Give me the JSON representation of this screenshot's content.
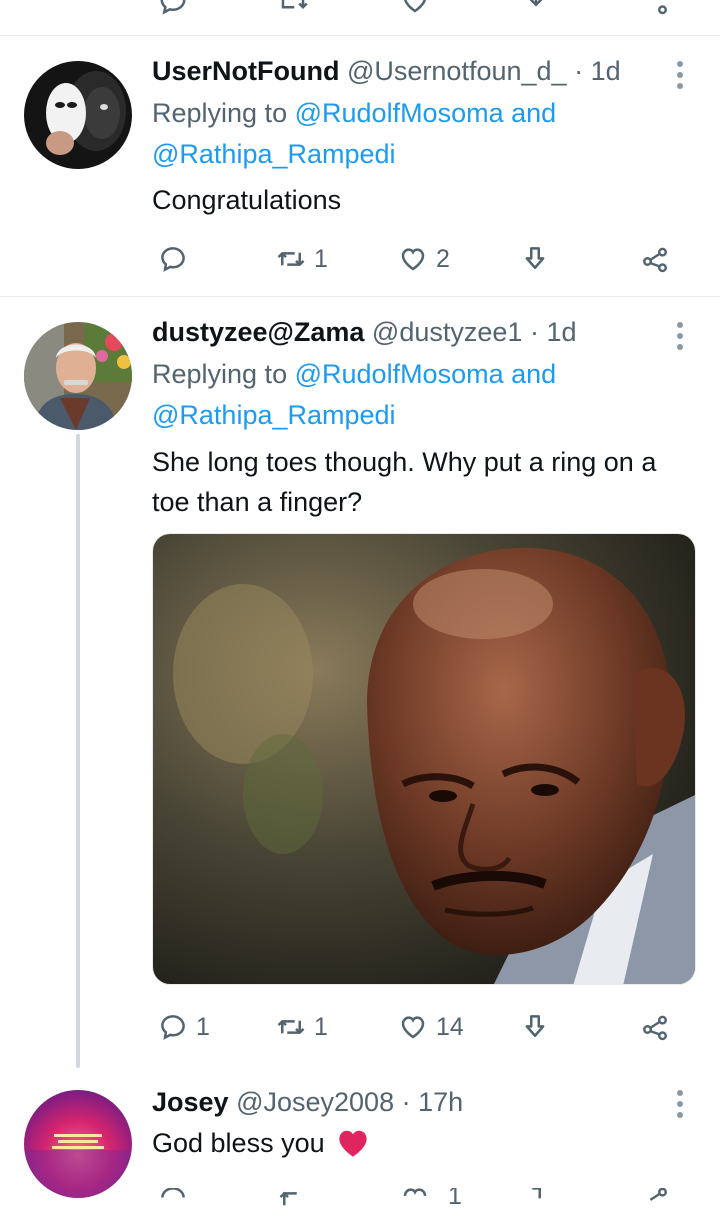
{
  "tweets": [
    {
      "display_name": "UserNotFound",
      "handle": "@Usernotfoun_d_",
      "dot": "·",
      "time": "1d",
      "replying_prefix": "Replying to",
      "mention_1": "@RudolfMosoma",
      "and": "and",
      "mention_2": "@Rathipa_Rampedi",
      "text": "Congratulations",
      "counts": {
        "reply": "",
        "retweet": "1",
        "like": "2"
      }
    },
    {
      "display_name": "dustyzee@Zama",
      "handle": "@dustyzee1",
      "dot": "·",
      "time": "1d",
      "replying_prefix": "Replying to",
      "mention_1": "@RudolfMosoma",
      "and": "and",
      "mention_2": "@Rathipa_Rampedi",
      "text": "She long toes though. Why put a ring on a toe than a finger?",
      "counts": {
        "reply": "1",
        "retweet": "1",
        "like": "14"
      }
    },
    {
      "display_name": "Josey",
      "handle": "@Josey2008",
      "dot": "·",
      "time": "17h",
      "text": "God bless you",
      "counts": {
        "reply": "",
        "retweet": "",
        "like": "1"
      },
      "avatar_text": "DON'T LET THE SUN GO DOWN WHILE YOU ARE STILL ANGRY"
    }
  ],
  "icons": {
    "reply": "reply-icon",
    "retweet": "retweet-icon",
    "like": "heart-icon",
    "bookmark": "bookmark-download-icon",
    "share": "share-icon",
    "more": "more-vertical-icon",
    "emoji": "red-heart-emoji"
  },
  "colors": {
    "link": "#1d9bf0",
    "secondary_text": "#536471",
    "primary_text": "#0f1419",
    "divider": "#e7e9eb",
    "heart_emoji": "#e0245e"
  }
}
